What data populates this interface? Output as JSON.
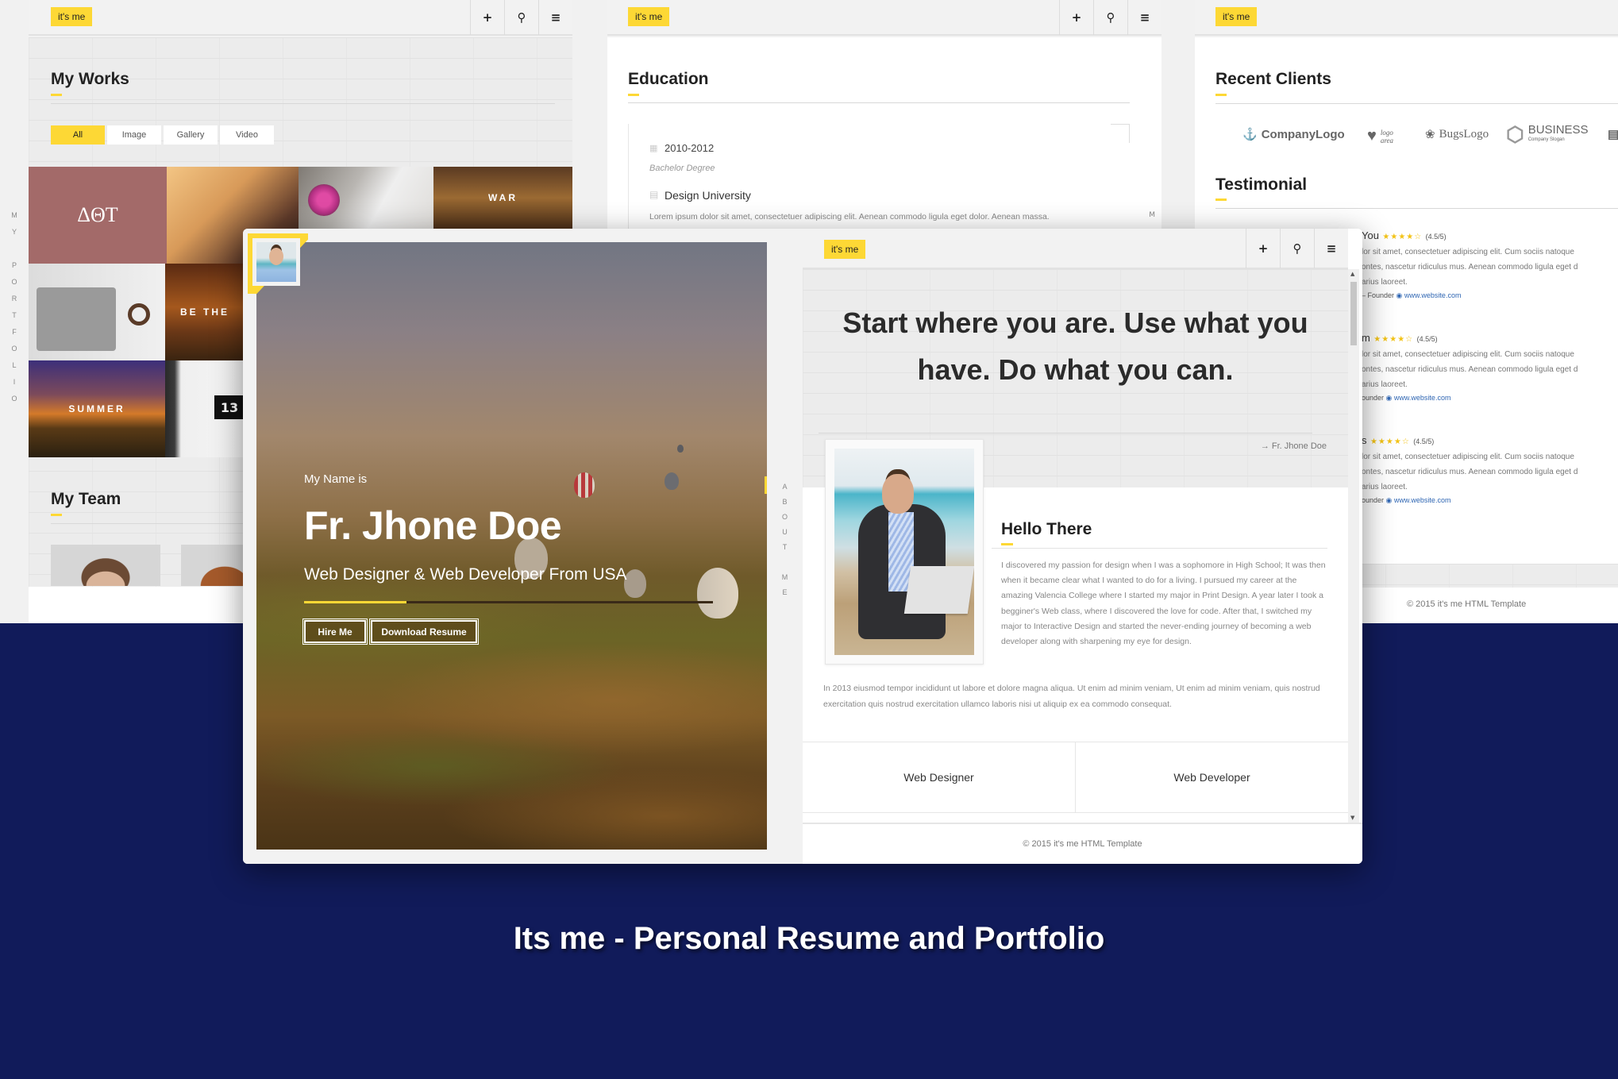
{
  "brand": {
    "logo_label": "it's me",
    "accent_color": "#fdd835",
    "page_bg_color": "#111b5a"
  },
  "header_icons": {
    "add": "plus-icon",
    "search": "search-icon",
    "menu": "menu-icon"
  },
  "left_panel": {
    "side_nav_letters": [
      "M",
      "Y",
      "",
      "P",
      "O",
      "R",
      "T",
      "F",
      "O",
      "L",
      "I",
      "O"
    ],
    "works": {
      "title": "My Works",
      "filters": [
        {
          "label": "All",
          "active": true
        },
        {
          "label": "Image",
          "active": false
        },
        {
          "label": "Gallery",
          "active": false
        },
        {
          "label": "Video",
          "active": false
        }
      ],
      "tiles": [
        "ΔΘT",
        "",
        "",
        "WAR",
        "",
        "BE THE",
        "SUMMER",
        "13"
      ]
    },
    "team": {
      "title": "My Team"
    }
  },
  "middle_panel": {
    "side_nav_letter": "M",
    "education": {
      "title": "Education",
      "entries": [
        {
          "years": "2010-2012",
          "degree": "Bachelor Degree",
          "school": "Design University",
          "description": "Lorem ipsum dolor sit amet, consectetuer adipiscing elit. Aenean commodo ligula eget dolor. Aenean massa."
        }
      ]
    }
  },
  "right_panel": {
    "clients": {
      "title": "Recent Clients",
      "logos": [
        "CompanyLogo",
        "logo area",
        "BugsLogo",
        "BUSINESS",
        "Company Slogan"
      ]
    },
    "testimonial": {
      "title": "Testimonial",
      "items": [
        {
          "name_fragment": "You",
          "stars": "★★★★☆",
          "rating": "(4.5/5)",
          "lines": [
            "lor sit amet, consectetuer adipiscing elit. Cum sociis natoque",
            "ontes, nascetur ridiculus mus. Aenean commodo ligula eget d",
            "arius laoreet."
          ],
          "role": "– Founder",
          "website": "www.website.com"
        },
        {
          "name_fragment": "m",
          "stars": "★★★★☆",
          "rating": "(4.5/5)",
          "lines": [
            "lor sit amet, consectetuer adipiscing elit. Cum sociis natoque",
            "ontes, nascetur ridiculus mus. Aenean commodo ligula eget d",
            "arius laoreet."
          ],
          "role": "ounder",
          "website": "www.website.com"
        },
        {
          "name_fragment": "s",
          "stars": "★★★★☆",
          "rating": "(4.5/5)",
          "lines": [
            "lor sit amet, consectetuer adipiscing elit. Cum sociis natoque",
            "ontes, nascetur ridiculus mus. Aenean commodo ligula eget d",
            "arius laoreet."
          ],
          "role": "ounder",
          "website": "www.website.com"
        }
      ]
    },
    "footer": "© 2015 it's me HTML Template"
  },
  "main_window": {
    "hero": {
      "intro": "My Name is",
      "name": "Fr. Jhone Doe",
      "subtitle": "Web Designer & Web Developer From USA",
      "progress": 0.25,
      "buttons": {
        "hire": "Hire Me",
        "download": "Download Resume"
      }
    },
    "side_nav_letters": [
      "A",
      "B",
      "O",
      "U",
      "T",
      "",
      "M",
      "E"
    ],
    "quote": {
      "text": "Start where you are. Use what you have. Do what you can.",
      "author": "→ Fr. Jhone Doe"
    },
    "about": {
      "title": "Hello There",
      "paragraph": "I discovered my passion for design when I was a sophomore in High School; It was then when it became clear what I wanted to do for a living. I pursued my career at the amazing Valencia College where I started my major in Print Design. A year later I took a begginer's Web class, where I discovered the love for code. After that, I switched my major to Interactive Design and started the never-ending journey of becoming a web developer along with sharpening my eye for design.",
      "paragraph2": "In 2013 eiusmod tempor incididunt ut labore et dolore magna aliqua. Ut enim ad minim veniam, Ut enim ad minim veniam, quis nostrud exercitation quis nostrud exercitation ullamco laboris nisi ut aliquip ex ea commodo consequat."
    },
    "skills": [
      "Web Designer",
      "Web Developer"
    ],
    "footer": "© 2015 it's me HTML Template"
  },
  "promo_title": "Its me - Personal Resume and Portfolio"
}
